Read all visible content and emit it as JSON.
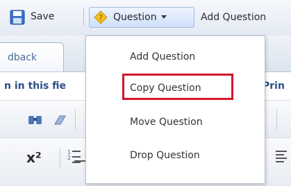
{
  "toolbar": {
    "save_label": "Save",
    "question_label": "Question",
    "add_question_label": "Add Question"
  },
  "tabs": {
    "feedback_tab": "dback"
  },
  "title": {
    "left_text": "n in this fie",
    "right_text": "Prin"
  },
  "dropdown": {
    "items": [
      {
        "label": "Add Question"
      },
      {
        "label": "Copy Question"
      },
      {
        "label": "Move Question"
      },
      {
        "label": "Drop Question"
      }
    ]
  },
  "editor": {
    "superscript_label": "x²"
  },
  "colors": {
    "highlight": "#d4142a",
    "title_text": "#2d4f86"
  },
  "icons": [
    "save-icon",
    "question-icon",
    "chevron-down-icon",
    "find-icon",
    "eraser-icon",
    "superscript-icon",
    "numbered-list-icon",
    "bulleted-list-icon",
    "align-icon"
  ]
}
